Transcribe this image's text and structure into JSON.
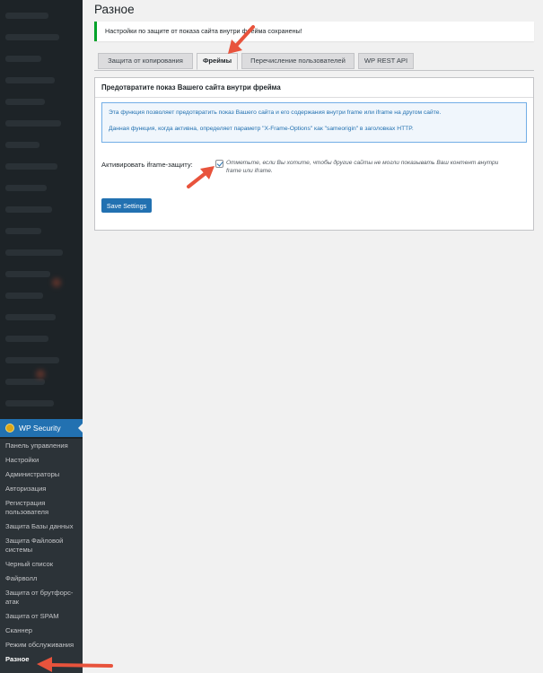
{
  "page": {
    "title": "Разное"
  },
  "notice": {
    "text": "Настройки по защите от показа сайта внутри фрейма сохранены!"
  },
  "tabs": [
    {
      "label": "Защита от копирования"
    },
    {
      "label": "Фреймы"
    },
    {
      "label": "Перечисление пользователей"
    },
    {
      "label": "WP REST API"
    }
  ],
  "panel": {
    "heading": "Предотвратите показ Вашего сайта внутри фрейма",
    "info_line1": "Эта функция позволяет предотвратить показ Вашего сайта и его содержания внутри frame или iframe на другом сайте.",
    "info_line2": "Данная функция, когда активна, определяет параметр \"X-Frame-Options\" как \"sameorigin\" в заголовках HTTP.",
    "option_label": "Активировать iframe-защиту:",
    "option_checked": true,
    "option_desc": "Отметьте, если Вы хотите, чтобы другие сайты не могли показывать Ваш контент внутри frame или iframe.",
    "save_label": "Save Settings"
  },
  "sidebar": {
    "plugin_title": "WP Security",
    "items": [
      {
        "label": "Панель управления"
      },
      {
        "label": "Настройки"
      },
      {
        "label": "Администраторы"
      },
      {
        "label": "Авторизация"
      },
      {
        "label": "Регистрация пользователя"
      },
      {
        "label": "Защита Базы данных"
      },
      {
        "label": "Защита Файловой системы"
      },
      {
        "label": "Черный список"
      },
      {
        "label": "Файрволл"
      },
      {
        "label": "Защита от брутфорс-атак"
      },
      {
        "label": "Защита от SPAM"
      },
      {
        "label": "Сканнер"
      },
      {
        "label": "Режим обслуживания"
      },
      {
        "label": "Разное"
      }
    ],
    "current_index": 13
  },
  "colors": {
    "accent": "#2271b1",
    "success": "#00a32a",
    "arrow": "#e8533c",
    "sidebar_bg": "#1d2327"
  }
}
